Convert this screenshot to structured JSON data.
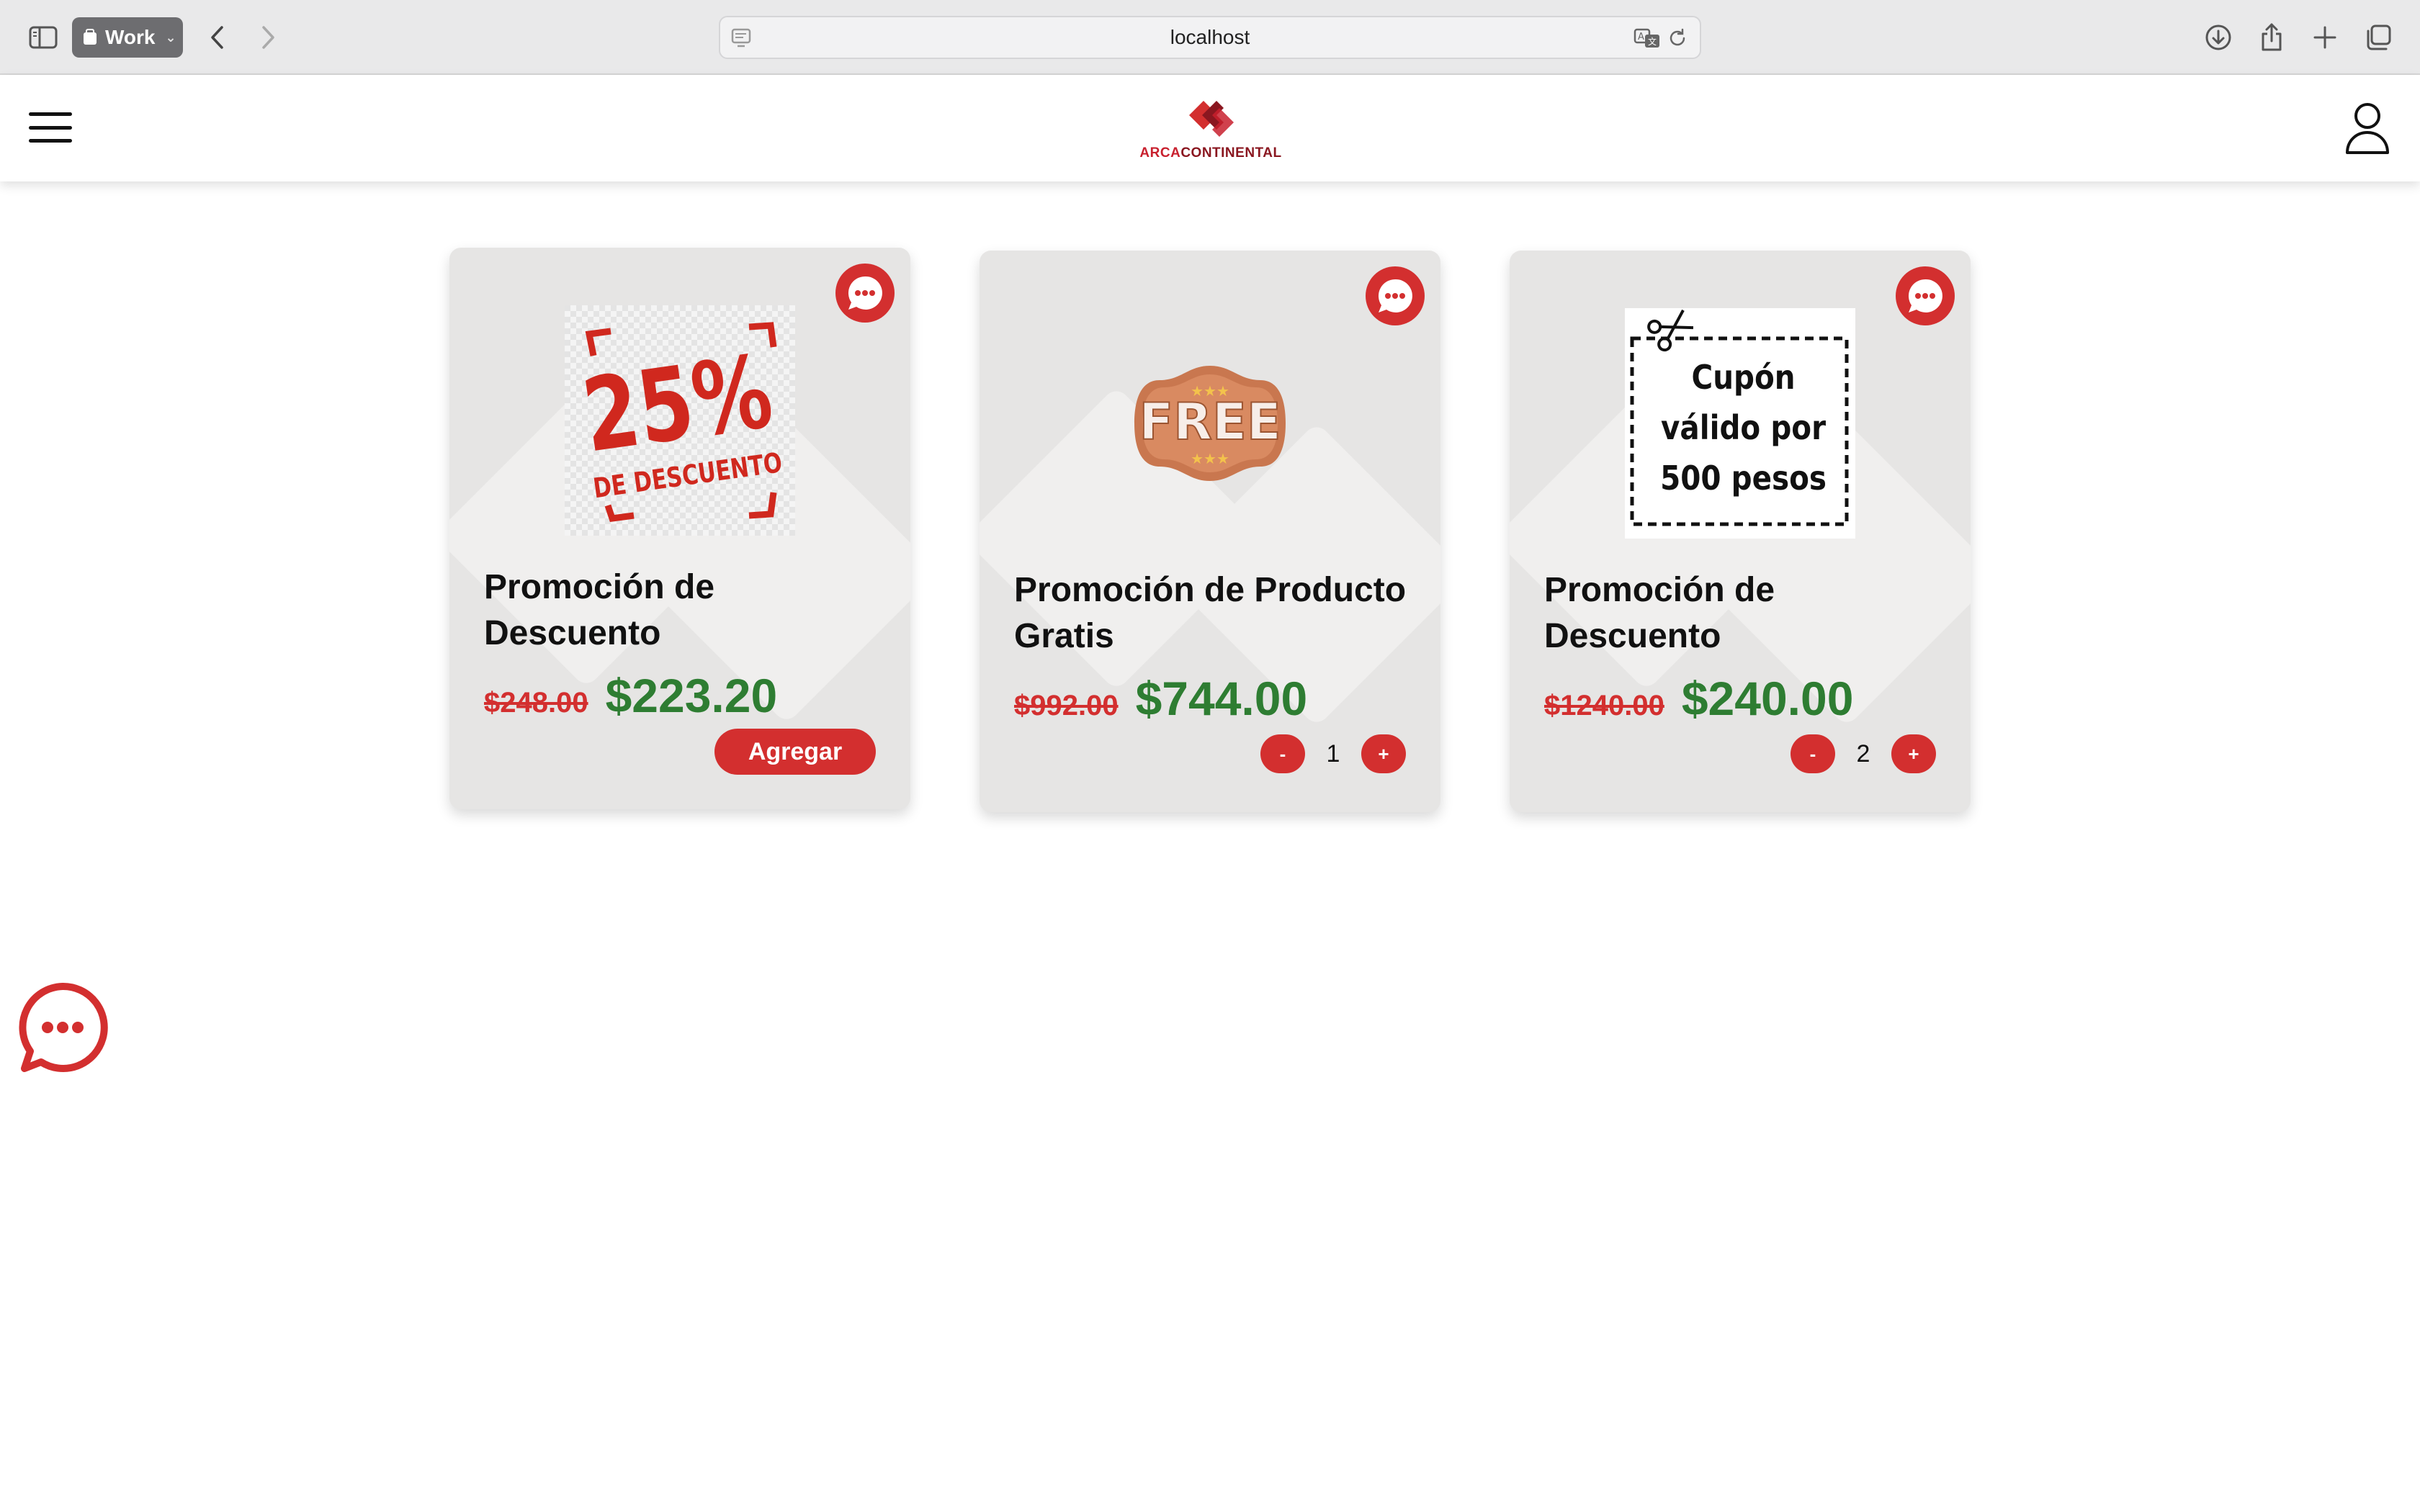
{
  "browser": {
    "tab_group_label": "Work",
    "url": "localhost",
    "icons": [
      "sidebar-icon",
      "back-icon",
      "forward-icon",
      "page-icon",
      "translate-icon",
      "reload-icon",
      "download-icon",
      "share-icon",
      "new-tab-icon",
      "tabs-overview-icon"
    ]
  },
  "header": {
    "logo_text_part1": "ARCA",
    "logo_text_part2": "CONTINENTAL",
    "menu_icon": "hamburger-icon",
    "user_icon": "user-icon"
  },
  "cards": [
    {
      "title": "Promoción de Descuento",
      "old_price": "$248.00",
      "new_price": "$223.20",
      "action": "add",
      "add_label": "Agregar",
      "image_lines": [
        "25%",
        "DE DESCUENTO"
      ]
    },
    {
      "title": "Promoción de Producto Gratis",
      "old_price": "$992.00",
      "new_price": "$744.00",
      "action": "quantity",
      "minus_label": "-",
      "quantity": "1",
      "plus_label": "+",
      "image_lines": [
        "FREE"
      ]
    },
    {
      "title": "Promoción de Descuento",
      "old_price": "$1240.00",
      "new_price": "$240.00",
      "action": "quantity",
      "minus_label": "-",
      "quantity": "2",
      "plus_label": "+",
      "image_lines": [
        "Cupón",
        "válido por",
        "500 pesos"
      ]
    }
  ],
  "colors": {
    "brand_red": "#d32f2f",
    "price_green": "#2e7d32",
    "card_bg": "#e6e5e4"
  }
}
